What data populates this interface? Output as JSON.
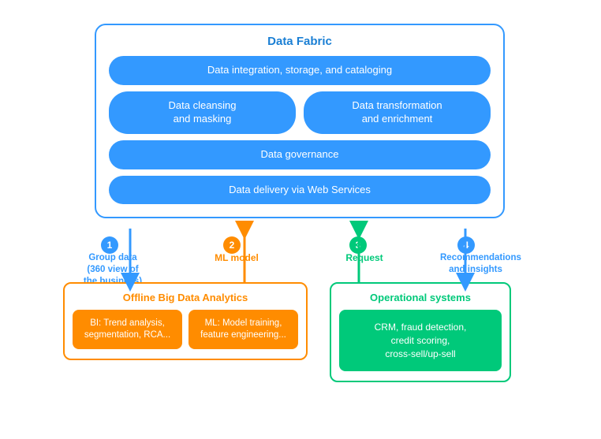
{
  "diagram": {
    "title": "Data Fabric",
    "fabric_rows": [
      {
        "id": "row1",
        "items": [
          {
            "id": "integration",
            "label": "Data integration, storage, and cataloging",
            "full": true
          }
        ]
      },
      {
        "id": "row2",
        "items": [
          {
            "id": "cleansing",
            "label": "Data cleansing\nand masking",
            "full": false
          },
          {
            "id": "transformation",
            "label": "Data transformation\nand enrichment",
            "full": false
          }
        ]
      },
      {
        "id": "row3",
        "items": [
          {
            "id": "governance",
            "label": "Data governance",
            "full": true
          }
        ]
      },
      {
        "id": "row4",
        "items": [
          {
            "id": "delivery",
            "label": "Data delivery via Web Services",
            "full": true
          }
        ]
      }
    ],
    "steps": [
      {
        "id": "step1",
        "number": "1",
        "label": "Group data\n(360 view of the business)",
        "color": "blue"
      },
      {
        "id": "step2",
        "number": "2",
        "label": "ML model",
        "color": "orange"
      },
      {
        "id": "step3",
        "number": "3",
        "label": "Request",
        "color": "green"
      },
      {
        "id": "step4",
        "number": "4",
        "label": "Recommendations\nand insights",
        "color": "blue"
      }
    ],
    "offline_box": {
      "title": "Offline Big Data Analytics",
      "items": [
        {
          "id": "bi",
          "label": "BI: Trend analysis, segmentation, RCA..."
        },
        {
          "id": "ml",
          "label": "ML: Model training, feature engineering..."
        }
      ]
    },
    "operational_box": {
      "title": "Operational systems",
      "item": {
        "id": "crm",
        "label": "CRM, fraud detection,\ncredit scoring,\ncross-sell/up-sell"
      }
    }
  }
}
